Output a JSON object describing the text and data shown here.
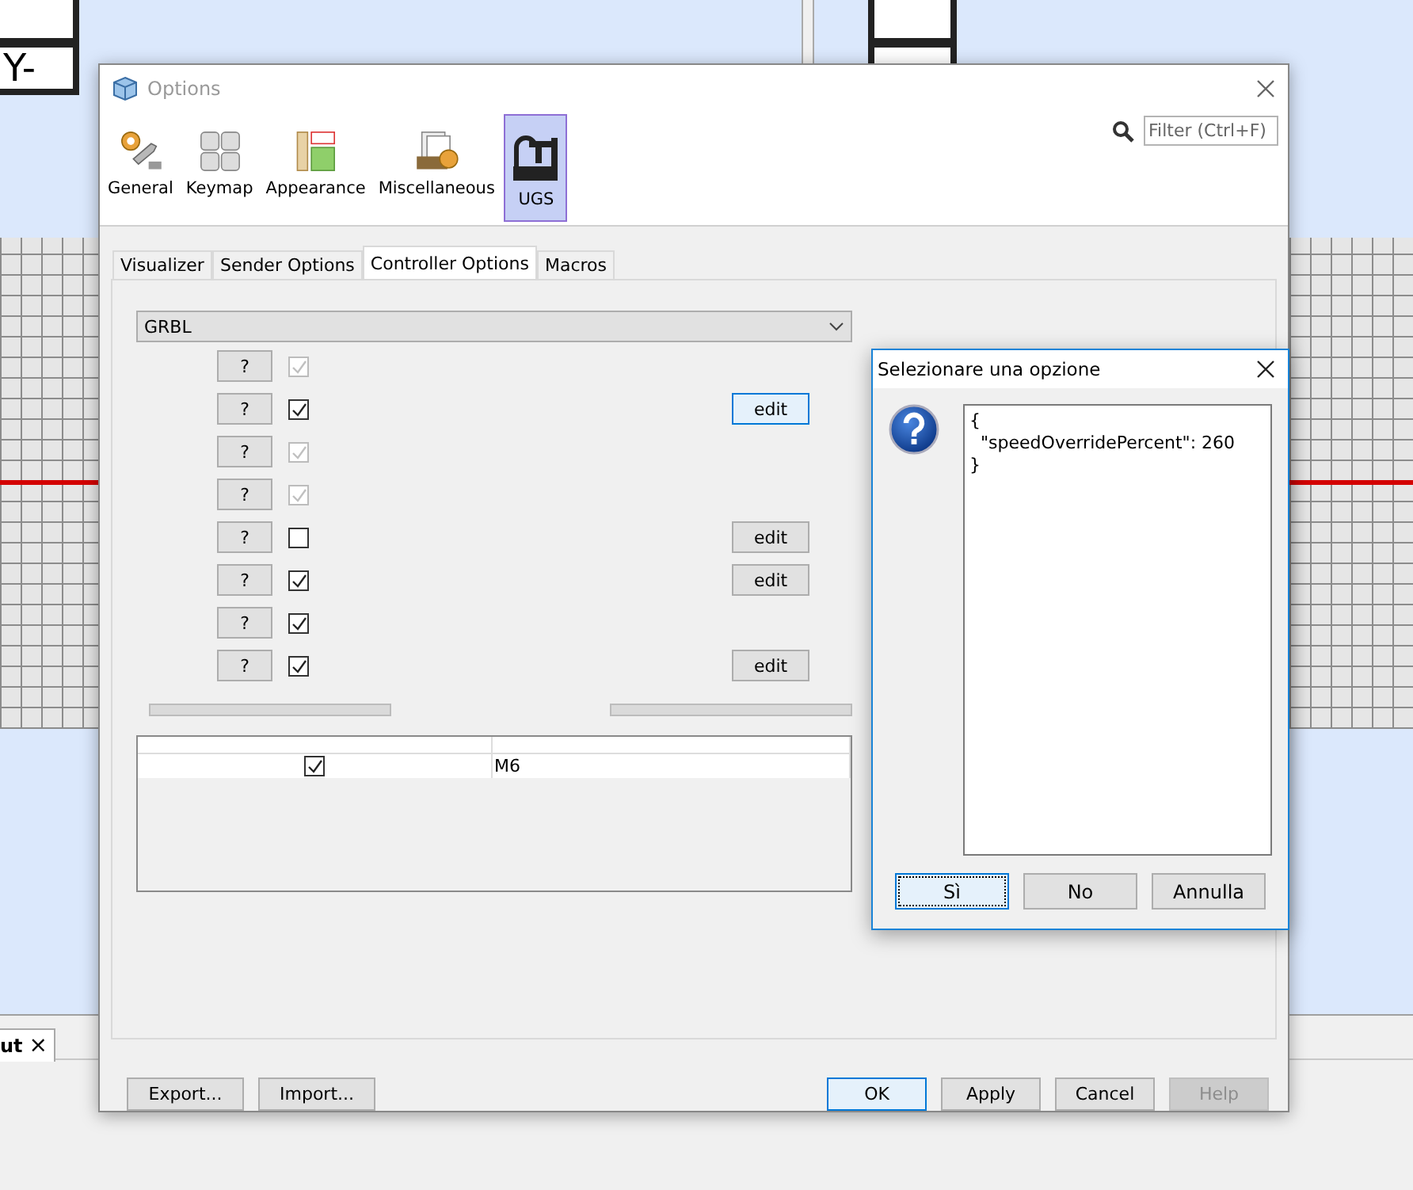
{
  "background": {
    "keys": [
      {
        "label": "Y-"
      }
    ],
    "output_tab": {
      "label": "ut",
      "close": "×"
    }
  },
  "options": {
    "title": "Options",
    "categories": [
      {
        "label": "General",
        "kind": "general",
        "selected": false
      },
      {
        "label": "Keymap",
        "kind": "keymap",
        "selected": false
      },
      {
        "label": "Appearance",
        "kind": "appearance",
        "selected": false
      },
      {
        "label": "Miscellaneous",
        "kind": "misc",
        "selected": false
      },
      {
        "label": "UGS",
        "kind": "ugs",
        "selected": true
      }
    ],
    "filter": {
      "placeholder": "Filter (Ctrl+F)"
    },
    "tabs": [
      {
        "label": "Visualizer",
        "selected": false
      },
      {
        "label": "Sender Options",
        "selected": false
      },
      {
        "label": "Controller Options",
        "selected": true
      },
      {
        "label": "Macros",
        "selected": false
      }
    ],
    "controller": {
      "value": "GRBL"
    },
    "settings": [
      {
        "help": "?",
        "checked": true,
        "disabled": true
      },
      {
        "help": "?",
        "checked": true,
        "disabled": false,
        "edit": {
          "label": "edit",
          "focused": true
        }
      },
      {
        "help": "?",
        "checked": true,
        "disabled": true
      },
      {
        "help": "?",
        "checked": true,
        "disabled": true
      },
      {
        "help": "?",
        "checked": false,
        "disabled": false,
        "edit": {
          "label": "edit",
          "focused": false
        }
      },
      {
        "help": "?",
        "checked": true,
        "disabled": false,
        "edit": {
          "label": "edit",
          "focused": false
        }
      },
      {
        "help": "?",
        "checked": true,
        "disabled": false
      },
      {
        "help": "?",
        "checked": true,
        "disabled": false,
        "edit": {
          "label": "edit",
          "focused": false
        }
      }
    ],
    "table": {
      "rows": [
        {
          "checked": true,
          "value": "M6"
        }
      ]
    },
    "left_buttons": [
      {
        "label": "Export...",
        "focused": false,
        "disabled": false
      },
      {
        "label": "Import...",
        "focused": false,
        "disabled": false
      }
    ],
    "right_buttons": [
      {
        "label": "OK",
        "focused": true,
        "disabled": false
      },
      {
        "label": "Apply",
        "focused": false,
        "disabled": false
      },
      {
        "label": "Cancel",
        "focused": false,
        "disabled": false
      },
      {
        "label": "Help",
        "focused": false,
        "disabled": true
      }
    ]
  },
  "prompt": {
    "title": "Selezionare una opzione",
    "text": "{\n  \"speedOverridePercent\": 260\n}",
    "buttons": [
      {
        "label": "Sì",
        "focused": true
      },
      {
        "label": "No",
        "focused": false
      },
      {
        "label": "Annulla",
        "focused": false
      }
    ]
  }
}
